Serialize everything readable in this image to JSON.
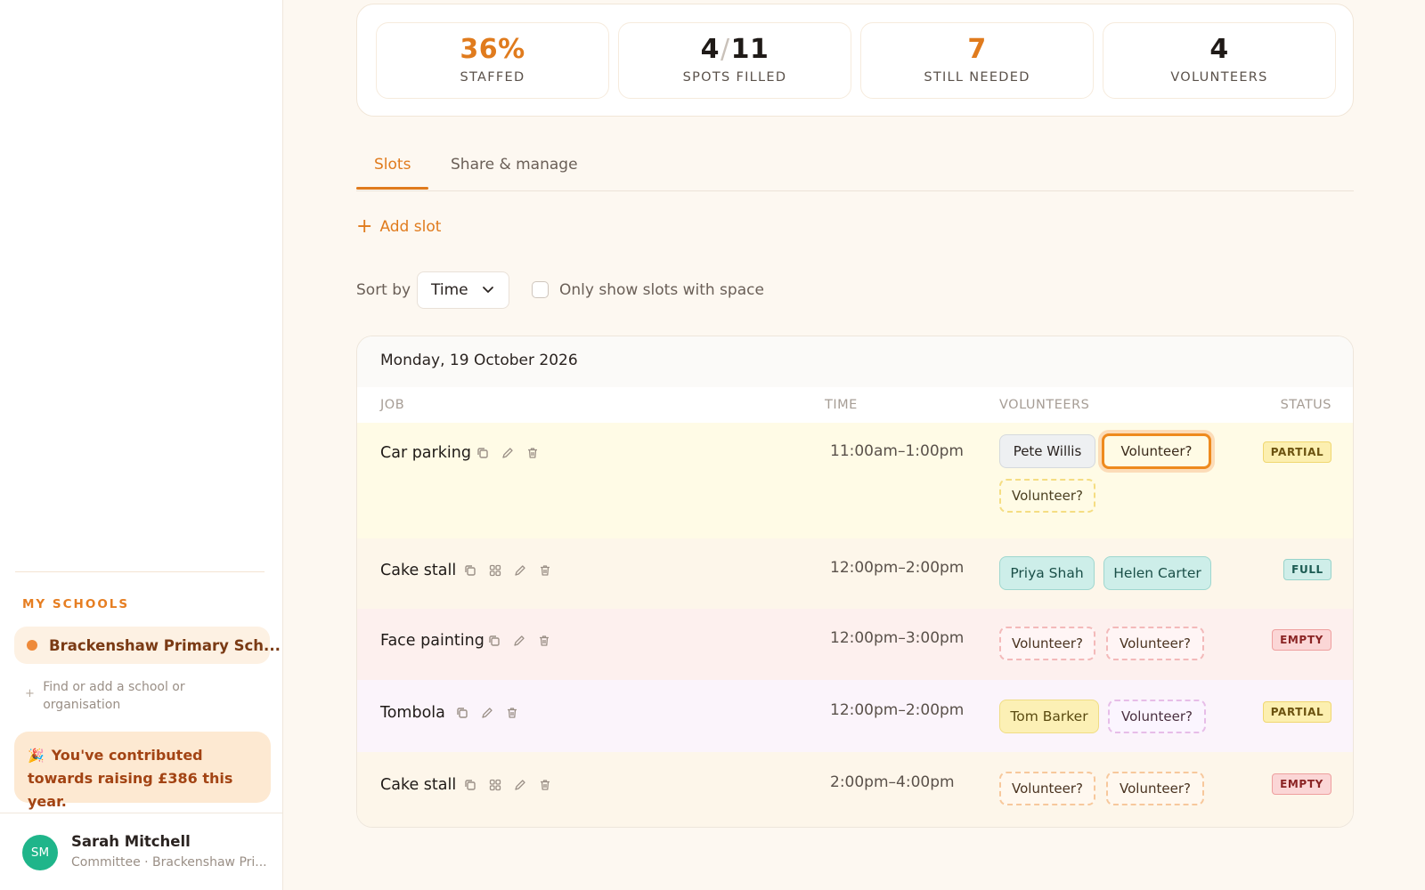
{
  "colors": {
    "accent": "#e07b1d",
    "avatar_bg": "#1fb58a",
    "row_partial_bg": "#fffbe6",
    "row_full_bg": "#fdf6ea",
    "row_empty_bg": "#fdf0ee",
    "row_tombola_bg": "#fbf4fb"
  },
  "sidebar": {
    "section_heading": "MY SCHOOLS",
    "school": {
      "name": "Brackenshaw Primary Sch...",
      "dot_color": "#ee8a3a"
    },
    "find_plus": "+",
    "find_label": "Find or add a school or organisation",
    "contribution": {
      "icon": "🎉",
      "text": "You've contributed towards raising £386 this year."
    },
    "user": {
      "initials": "SM",
      "name": "Sarah Mitchell",
      "subtitle": "Committee · Brackenshaw Pri..."
    }
  },
  "stats": {
    "staffed": {
      "value": "36%",
      "label": "STAFFED"
    },
    "spots": {
      "filled": "4",
      "total": "11",
      "separator": "/",
      "label": "SPOTS FILLED"
    },
    "needed": {
      "value": "7",
      "label": "STILL NEEDED"
    },
    "volunteers": {
      "value": "4",
      "label": "VOLUNTEERS"
    }
  },
  "tabs": [
    {
      "label": "Slots",
      "active": true
    },
    {
      "label": "Share & manage",
      "active": false
    }
  ],
  "toolbar": {
    "add_icon": "+",
    "add_label": "Add slot",
    "sort_label": "Sort by",
    "sort_value": "Time",
    "filter_label": "Only show slots with space",
    "filter_checked": false
  },
  "table": {
    "date": "Monday, 19 October 2026",
    "headers": {
      "job": "JOB",
      "time": "TIME",
      "volunteers": "VOLUNTEERS",
      "status": "STATUS"
    },
    "rows": [
      {
        "job": "Car parking",
        "time": "11:00am–1:00pm",
        "status": "PARTIAL",
        "icons": [
          "copy-icon",
          "edit-icon",
          "delete-icon"
        ],
        "chips": [
          {
            "label": "Pete Willis",
            "style": "grey"
          },
          {
            "label": "Volunteer?",
            "style": "selected"
          },
          {
            "label": "Volunteer?",
            "style": "dash-y"
          }
        ]
      },
      {
        "job": "Cake stall",
        "time": "12:00pm–2:00pm",
        "status": "FULL",
        "icons": [
          "copy-icon",
          "grid-icon",
          "edit-icon",
          "delete-icon"
        ],
        "chips": [
          {
            "label": "Priya Shah",
            "style": "teal"
          },
          {
            "label": "Helen Carter",
            "style": "teal"
          }
        ]
      },
      {
        "job": "Face painting",
        "time": "12:00pm–3:00pm",
        "status": "EMPTY",
        "icons": [
          "copy-icon",
          "edit-icon",
          "delete-icon"
        ],
        "chips": [
          {
            "label": "Volunteer?",
            "style": "dash-p"
          },
          {
            "label": "Volunteer?",
            "style": "dash-p"
          }
        ]
      },
      {
        "job": "Tombola",
        "time": "12:00pm–2:00pm",
        "status": "PARTIAL",
        "icons": [
          "copy-icon",
          "edit-icon",
          "delete-icon"
        ],
        "chips": [
          {
            "label": "Tom Barker",
            "style": "yellow"
          },
          {
            "label": "Volunteer?",
            "style": "dash-v"
          }
        ]
      },
      {
        "job": "Cake stall",
        "time": "2:00pm–4:00pm",
        "status": "EMPTY",
        "icons": [
          "copy-icon",
          "grid-icon",
          "edit-icon",
          "delete-icon"
        ],
        "chips": [
          {
            "label": "Volunteer?",
            "style": "dash-o"
          },
          {
            "label": "Volunteer?",
            "style": "dash-o"
          }
        ]
      }
    ]
  }
}
